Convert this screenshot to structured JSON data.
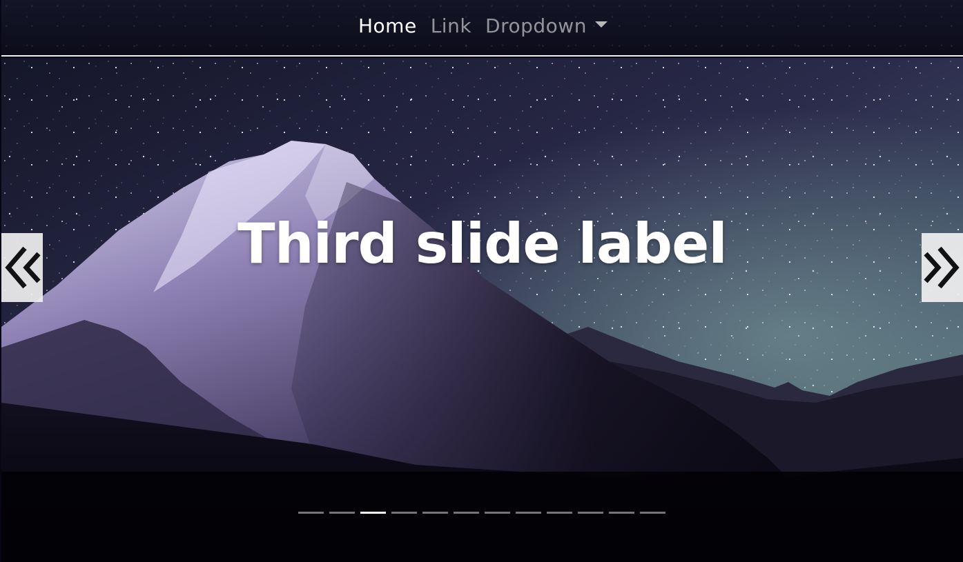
{
  "navbar": {
    "items": [
      {
        "label": "Home",
        "active": true
      },
      {
        "label": "Link",
        "active": false
      },
      {
        "label": "Dropdown",
        "active": false,
        "has_dropdown": true
      }
    ]
  },
  "carousel": {
    "caption": "Third slide label",
    "prev_icon": "chevron-double-left-icon",
    "next_icon": "chevron-double-right-icon",
    "indicator_count": 12,
    "active_index": 2,
    "slide_image": "starry-night-mountain"
  },
  "colors": {
    "caption": "#ffffff",
    "nav_active": "#ffffff",
    "nav_inactive": "#8c8c99",
    "control_bg": "#f0f0f0",
    "indicator_active": "#ffffff",
    "indicator_inactive": "#737373"
  }
}
